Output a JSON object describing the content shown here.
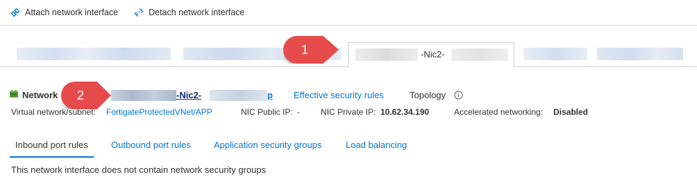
{
  "toolbar": {
    "attach_label": "Attach network interface",
    "detach_label": "Detach network interface"
  },
  "nic_tabs": {
    "active_label": "-Nic2-"
  },
  "callouts": {
    "first": "1",
    "second": "2"
  },
  "interface": {
    "label": "Network",
    "name_text": "-Nic2-",
    "name_end": "p",
    "effective_rules_link": "Effective security rules",
    "topology_label": "Topology"
  },
  "meta": {
    "vnet_label": "Virtual network/subnet:",
    "vnet_value": "FortigateProtectedVNet/APP",
    "public_ip_label": "NIC Public IP:",
    "public_ip_value": "-",
    "private_ip_label": "NIC Private IP:",
    "private_ip_value": "10.62.34.190",
    "accel_label": "Accelerated networking:",
    "accel_value": "Disabled"
  },
  "rule_tabs": {
    "inbound": "Inbound port rules",
    "outbound": "Outbound port rules",
    "asg": "Application security groups",
    "lb": "Load balancing"
  },
  "content": {
    "empty_message": "This network interface does not contain network security groups"
  },
  "colors": {
    "accent": "#0078d4",
    "callout": "#e64b4b",
    "text": "#323130"
  }
}
